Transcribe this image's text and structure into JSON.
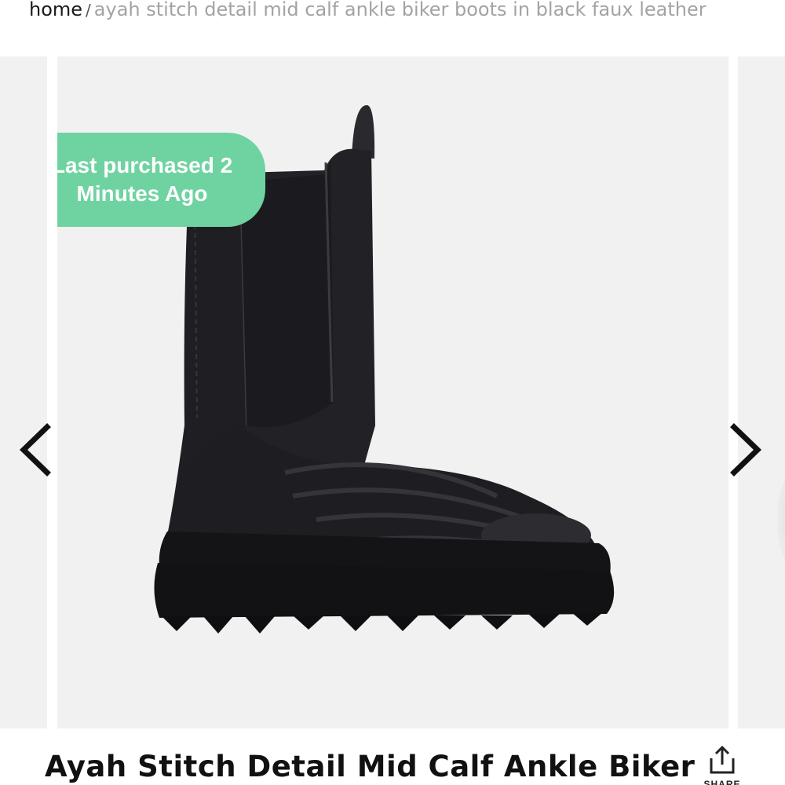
{
  "breadcrumb": {
    "home": "home",
    "separator": "/",
    "current": "ayah stitch detail mid calf ankle biker boots in black faux leather"
  },
  "gallery": {
    "badge": "Last purchased 2 Minutes Ago",
    "prev_icon": "chevron-left-icon",
    "next_icon": "chevron-right-icon",
    "image_subject": "black boot",
    "background_color": "#f1f1f1"
  },
  "product": {
    "title": "Ayah Stitch Detail Mid Calf Ankle Biker",
    "share_label": "SHARE",
    "share_icon": "share-icon"
  },
  "colors": {
    "badge": "#6ed3a1",
    "text": "#111111",
    "breadcrumb_muted": "#a3a3a3"
  }
}
